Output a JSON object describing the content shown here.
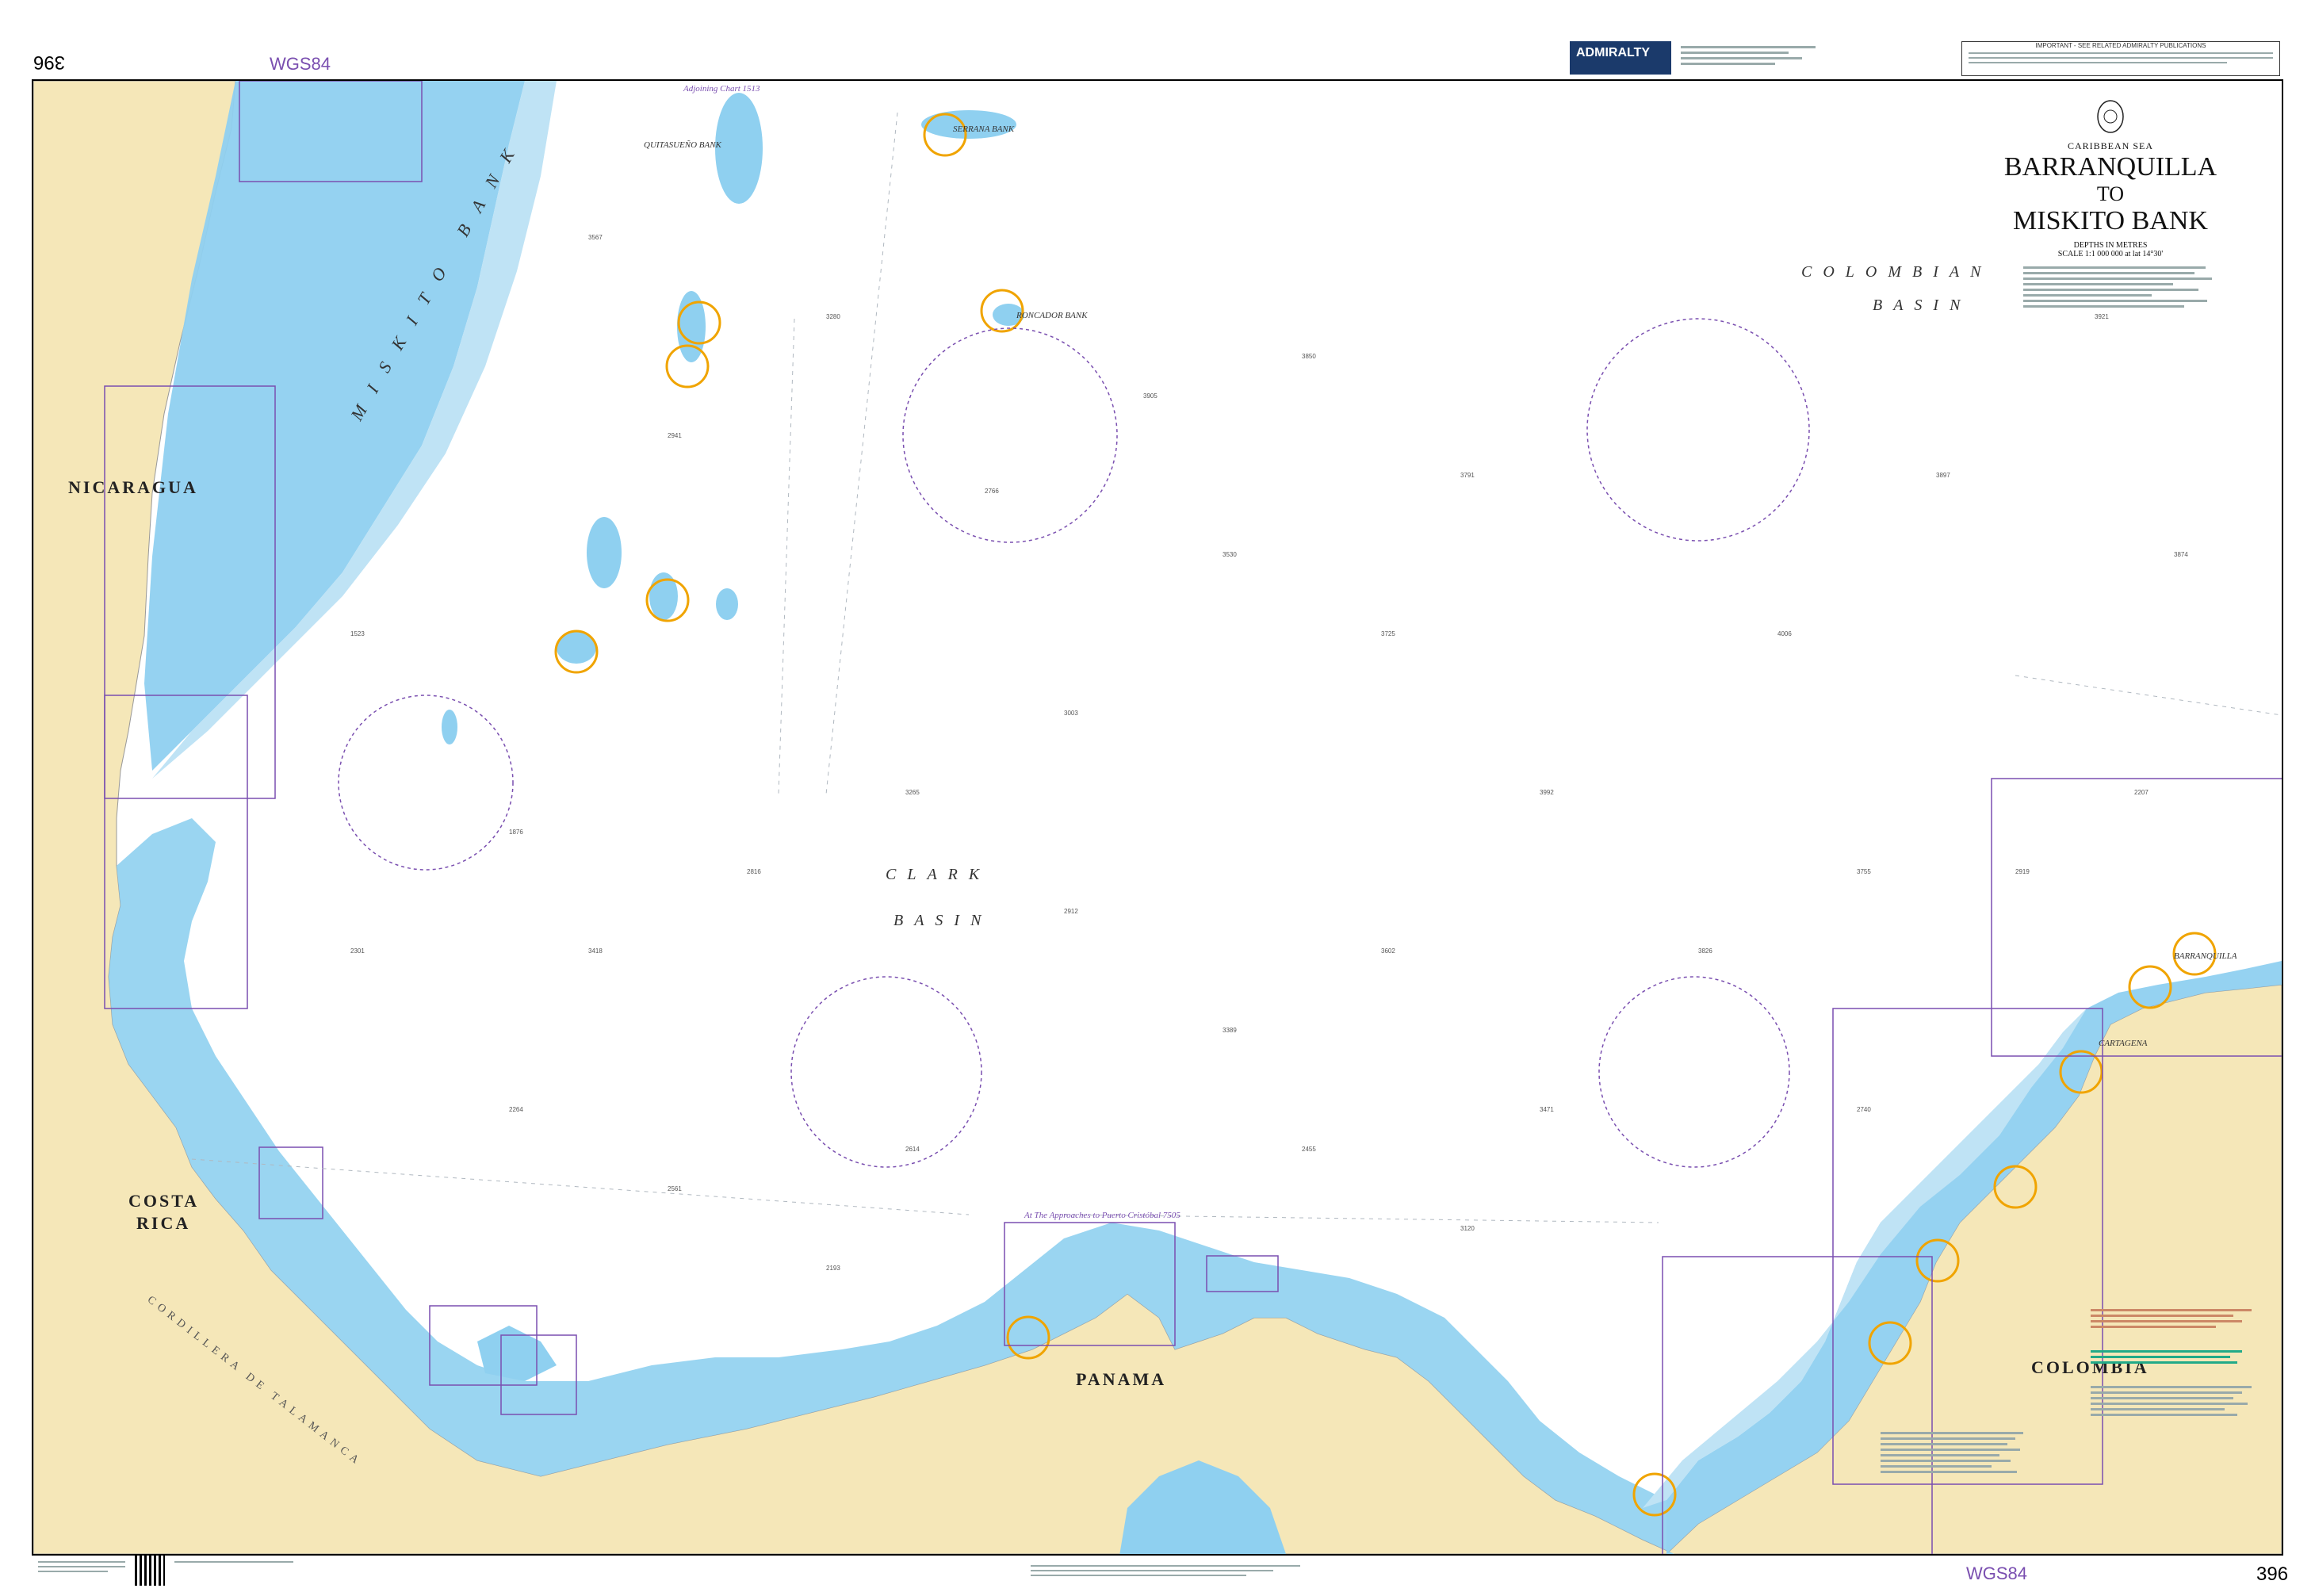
{
  "chart": {
    "number": "396",
    "datum": "WGS84",
    "region": "CARIBBEAN SEA",
    "title_line1": "BARRANQUILLA",
    "title_line2": "TO",
    "title_line3": "MISKITO BANK",
    "depth_units": "DEPTHS IN METRES",
    "scale": "SCALE 1:1 000 000 at lat 14°30'"
  },
  "brand": {
    "logo_text": "ADMIRALTY",
    "notice_title": "IMPORTANT - SEE RELATED ADMIRALTY PUBLICATIONS"
  },
  "land_labels": {
    "nicaragua": "NICARAGUA",
    "costa": "COSTA",
    "rica": "RICA",
    "panama": "PANAMA",
    "colombia": "COLOMBIA",
    "cordillera": "CORDILLERA DE TALAMANCA"
  },
  "sea_labels": {
    "colombian": "COLOMBIAN",
    "basin1": "BASIN",
    "clark": "CLARK",
    "basin2": "BASIN",
    "miskito_bank": "MISKITO BANK"
  },
  "features": {
    "serrana": "SERRANA BANK",
    "roncador": "RONCADOR BANK",
    "quitasueno": "QUITASUEÑO BANK",
    "barranquilla": "BARRANQUILLA",
    "cartagena": "CARTAGENA",
    "puerto_cristobal": "At The Approaches to Puerto Cristóbal 7505",
    "adjoining": "Adjoining Chart 1513"
  },
  "colors": {
    "land": "#f5e7b8",
    "shallow": "#8fd0f0",
    "medium": "#bfe3f5",
    "deep": "#ffffff",
    "highlight": "#f0a400",
    "limits": "#7a4fb0"
  }
}
